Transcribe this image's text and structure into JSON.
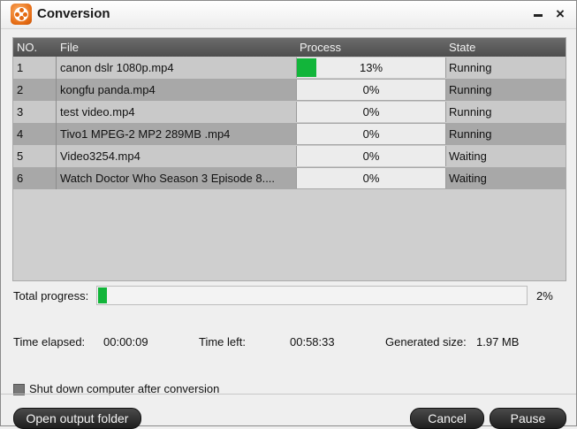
{
  "window": {
    "title": "Conversion",
    "minimize_glyph": "",
    "close_glyph": "×"
  },
  "table": {
    "headers": {
      "no": "NO.",
      "file": "File",
      "process": "Process",
      "state": "State"
    },
    "rows": [
      {
        "no": "1",
        "file": "canon dslr 1080p.mp4",
        "progress_percent": 13,
        "progress_label": "13%",
        "state": "Running"
      },
      {
        "no": "2",
        "file": "kongfu panda.mp4",
        "progress_percent": 0,
        "progress_label": "0%",
        "state": "Running"
      },
      {
        "no": "3",
        "file": "test video.mp4",
        "progress_percent": 0,
        "progress_label": "0%",
        "state": "Running"
      },
      {
        "no": "4",
        "file": "Tivo1 MPEG-2 MP2 289MB .mp4",
        "progress_percent": 0,
        "progress_label": "0%",
        "state": "Running"
      },
      {
        "no": "5",
        "file": "Video3254.mp4",
        "progress_percent": 0,
        "progress_label": "0%",
        "state": "Waiting"
      },
      {
        "no": "6",
        "file": "Watch Doctor Who Season 3 Episode 8....",
        "progress_percent": 0,
        "progress_label": "0%",
        "state": "Waiting"
      }
    ]
  },
  "total": {
    "label": "Total progress:",
    "percent": 2,
    "percent_label": "2%"
  },
  "stats": {
    "elapsed_label": "Time elapsed:",
    "elapsed_value": "00:00:09",
    "left_label": "Time left:",
    "left_value": "00:58:33",
    "size_label": "Generated size:",
    "size_value": "1.97 MB"
  },
  "shutdown": {
    "label": "Shut down computer after conversion",
    "checked": false
  },
  "buttons": {
    "open_output": "Open output folder",
    "cancel": "Cancel",
    "pause": "Pause"
  },
  "colors": {
    "progress_fill": "#12b53a",
    "accent_icon": "#e46a12"
  },
  "icons": {
    "app": "video-reel-icon",
    "minimize": "minimize-icon",
    "close": "close-icon"
  }
}
